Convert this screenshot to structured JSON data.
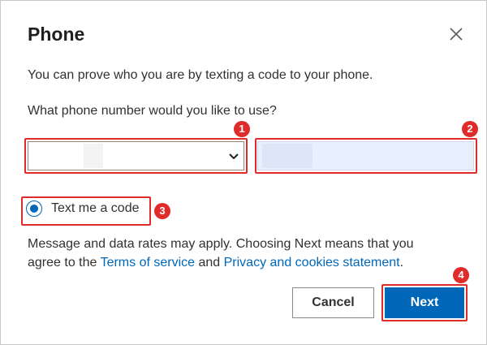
{
  "dialog": {
    "title": "Phone",
    "close_icon": "close-icon"
  },
  "content": {
    "intro": "You can prove who you are by texting a code to your phone.",
    "question": "What phone number would you like to use?",
    "country_select": {
      "value": "",
      "icon": "chevron-down-icon"
    },
    "phone_input": {
      "value": "",
      "placeholder": ""
    },
    "option": {
      "label": "Text me a code",
      "selected": true
    },
    "legal": {
      "line1": "Message and data rates may apply. Choosing Next means that you",
      "line2_prefix": "agree to the ",
      "terms_link": "Terms of service",
      "and": " and ",
      "privacy_link": "Privacy and cookies statement",
      "period": "."
    }
  },
  "buttons": {
    "cancel": "Cancel",
    "next": "Next"
  },
  "annotations": {
    "a1": "1",
    "a2": "2",
    "a3": "3",
    "a4": "4"
  },
  "colors": {
    "accent": "#0067b8",
    "annotation": "#e02b2b"
  }
}
